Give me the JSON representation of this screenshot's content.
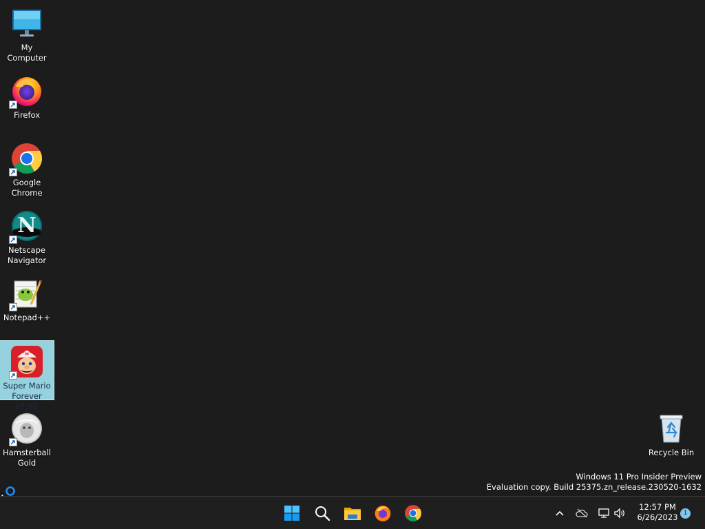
{
  "desktop": {
    "icons": [
      {
        "label": "My Computer",
        "icon": "monitor-icon",
        "shortcut": false
      },
      {
        "label": "Firefox",
        "icon": "firefox-icon",
        "shortcut": true
      },
      {
        "label": "Google\nChrome",
        "icon": "chrome-icon",
        "shortcut": true
      },
      {
        "label": "Netscape\nNavigator",
        "icon": "netscape-icon",
        "shortcut": true
      },
      {
        "label": "Notepad++",
        "icon": "notepadpp-icon",
        "shortcut": true
      },
      {
        "label": "Super Mario\nForever v7.02",
        "icon": "mario-icon",
        "shortcut": true,
        "selected": true
      },
      {
        "label": "Hamsterball\nGold",
        "icon": "hamsterball-icon",
        "shortcut": true
      },
      {
        "label": "Recycle Bin",
        "icon": "recycle-bin-icon",
        "shortcut": false
      }
    ],
    "watermark": {
      "line1": "Windows 11 Pro Insider Preview",
      "line2": "Evaluation copy. Build 25375.zn_release.230520-1632"
    }
  },
  "taskbar": {
    "apps": [
      "start-icon",
      "search-icon",
      "file-explorer-icon",
      "firefox-icon",
      "chrome-icon"
    ],
    "tray": [
      "chevron-up-icon",
      "onedrive-offline-icon",
      "network-icon",
      "volume-icon"
    ],
    "time": "12:57 PM",
    "date": "6/26/2023",
    "notification_count": "1"
  },
  "colors": {
    "desktop_bg": "#1c1c1c",
    "taskbar_bg": "#1f1f1f",
    "selection": "#9cdce8",
    "accent": "#0078d4"
  }
}
